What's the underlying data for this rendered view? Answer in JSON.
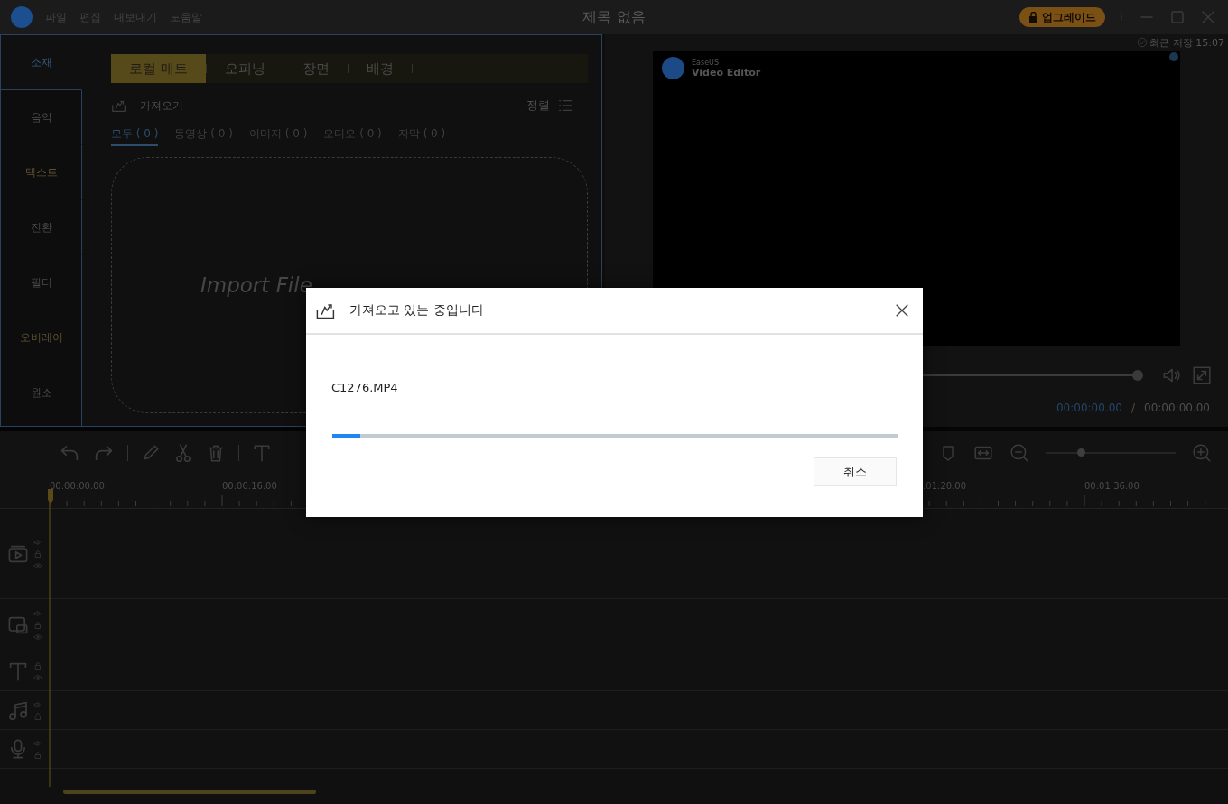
{
  "title_bar": {
    "menu": [
      "파일",
      "편집",
      "내보내기",
      "도움말"
    ],
    "title": "제목 없음",
    "upgrade_button": "업그레이드"
  },
  "library": {
    "nav": [
      {
        "label": "소재",
        "selected": true,
        "accent": false
      },
      {
        "label": "음악",
        "selected": false,
        "accent": false
      },
      {
        "label": "텍스트",
        "selected": false,
        "accent": true
      },
      {
        "label": "전환",
        "selected": false,
        "accent": false
      },
      {
        "label": "필터",
        "selected": false,
        "accent": false
      },
      {
        "label": "오버레이",
        "selected": false,
        "accent": true
      },
      {
        "label": "원소",
        "selected": false,
        "accent": false
      }
    ],
    "tabs": [
      {
        "label": "로컬 매트",
        "selected": true
      },
      {
        "label": "오피닝",
        "selected": false
      },
      {
        "label": "장면",
        "selected": false
      },
      {
        "label": "배경",
        "selected": false
      }
    ],
    "import_label": "가져오기",
    "sort_label": "정렬",
    "filters": [
      {
        "label": "모두 ( 0 )",
        "selected": true
      },
      {
        "label": "동영상 ( 0 )",
        "selected": false
      },
      {
        "label": "이미지 ( 0 )",
        "selected": false
      },
      {
        "label": "오디오 ( 0 )",
        "selected": false
      },
      {
        "label": "자막 ( 0 )",
        "selected": false
      }
    ],
    "drop_hint": "Import File"
  },
  "preview": {
    "save_status": "최근 저장 15:07",
    "brand": "EaseUS",
    "product": "Video Editor",
    "playback": {
      "level": 1
    },
    "current_time": "00:00:00.00",
    "separator": "/",
    "total_time": "00:00:00.00"
  },
  "timeline": {
    "zoom": {
      "level": 0.28
    },
    "ruler": [
      "00:00:00.00",
      "00:00:16.00",
      ":01:20.00",
      "00:01:36.00"
    ],
    "tracks": [
      {
        "kind": "video"
      },
      {
        "kind": "overlay"
      },
      {
        "kind": "text"
      },
      {
        "kind": "music"
      },
      {
        "kind": "voice"
      }
    ]
  },
  "dialog": {
    "title": "가져오고 있는 중입니다",
    "file": "C1276.MP4",
    "progress": {
      "level": 0.05
    },
    "cancel": "취소"
  }
}
